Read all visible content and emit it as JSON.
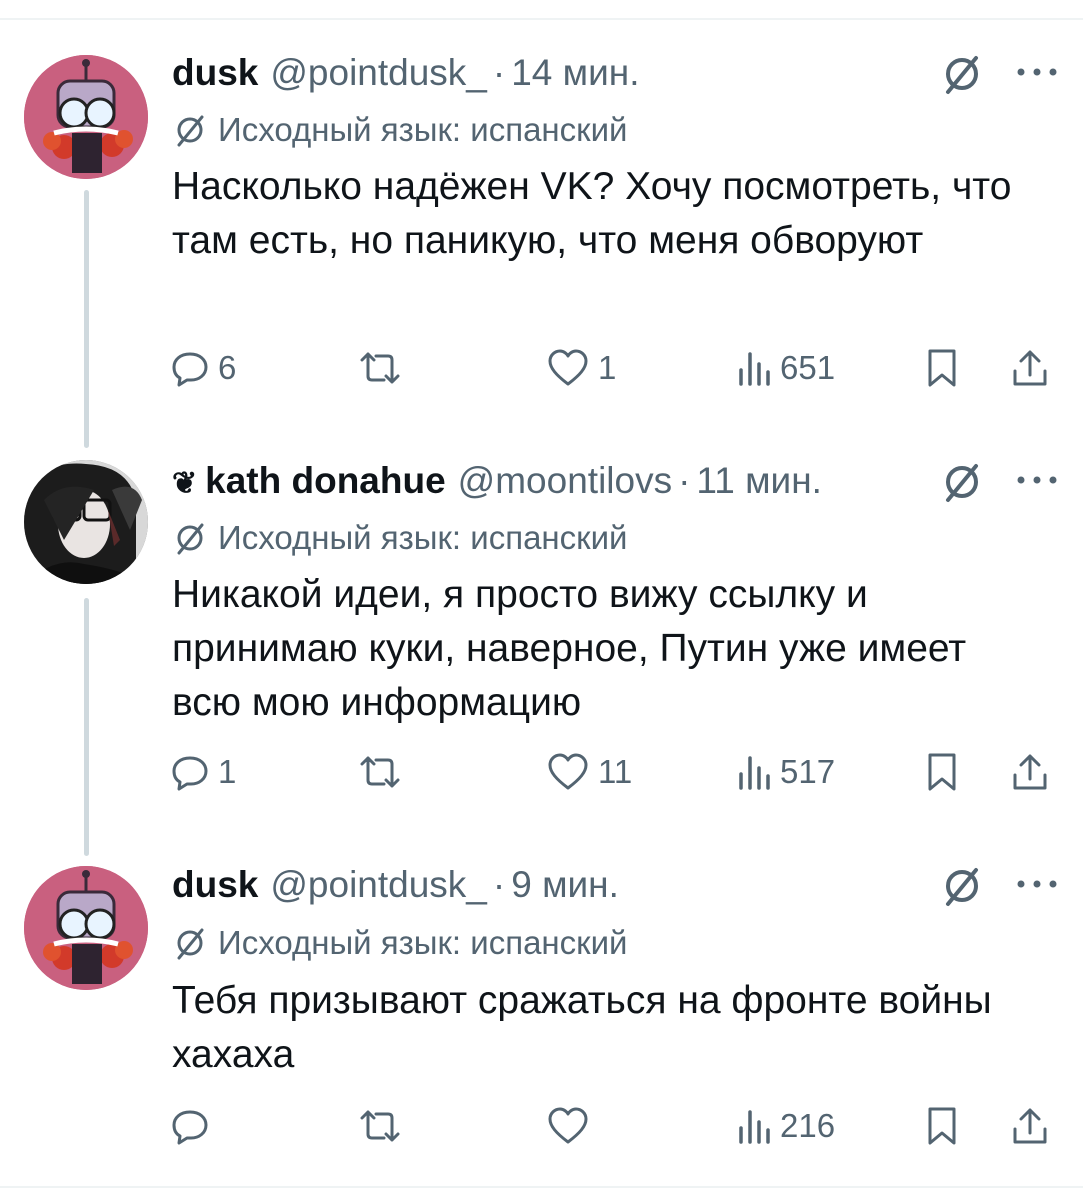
{
  "lang_label": "Исходный язык: испанский",
  "tweets": [
    {
      "display_name": "dusk",
      "handle": "@pointdusk_",
      "separator": "·",
      "time": "14 мин.",
      "text": "Насколько надёжен VK? Хочу посмотреть, что там есть, но паникую, что меня обворуют",
      "replies": "6",
      "retweets": "",
      "likes": "1",
      "views": "651"
    },
    {
      "name_badge": "❦",
      "display_name": "kath donahue",
      "handle": "@moontilovs",
      "separator": "·",
      "time": "11 мин.",
      "text": "Никакой идеи, я просто вижу ссылку и принимаю куки, наверное, Путин уже имеет всю мою информацию",
      "replies": "1",
      "retweets": "",
      "likes": "11",
      "views": "517"
    },
    {
      "display_name": "dusk",
      "handle": "@pointdusk_",
      "separator": "·",
      "time": "9 мин.",
      "text": "Тебя призывают сражаться на фронте войны хахаха",
      "replies": "",
      "retweets": "",
      "likes": "",
      "views": "216"
    }
  ],
  "colors": {
    "primary_text": "#0f1419",
    "secondary_text": "#536471",
    "thread_line": "#cfd9de",
    "divider": "#eff3f4"
  }
}
